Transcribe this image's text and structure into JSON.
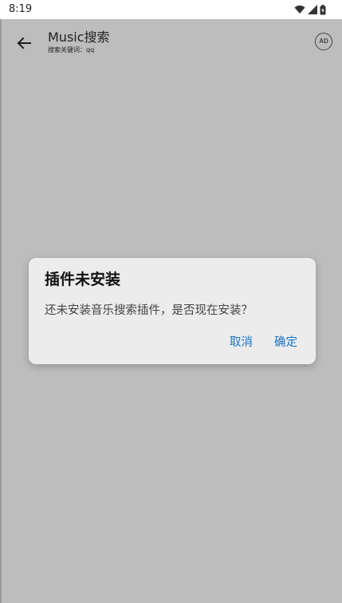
{
  "status_bar": {
    "time": "8:19",
    "icons": [
      "wifi-icon",
      "cellular-signal-icon",
      "battery-icon"
    ]
  },
  "app_bar": {
    "title": "Music搜索",
    "subtitle": "搜索关键词：qq",
    "ad_label": "AD",
    "back_icon": "arrow-left-icon"
  },
  "dialog": {
    "title": "插件未安装",
    "message": "还未安装音乐搜索插件，是否现在安装？",
    "cancel_label": "取消",
    "confirm_label": "确定"
  },
  "colors": {
    "overlay": "#bdbdbd",
    "dialog_bg": "#ececec",
    "accent": "#1a73c8"
  }
}
